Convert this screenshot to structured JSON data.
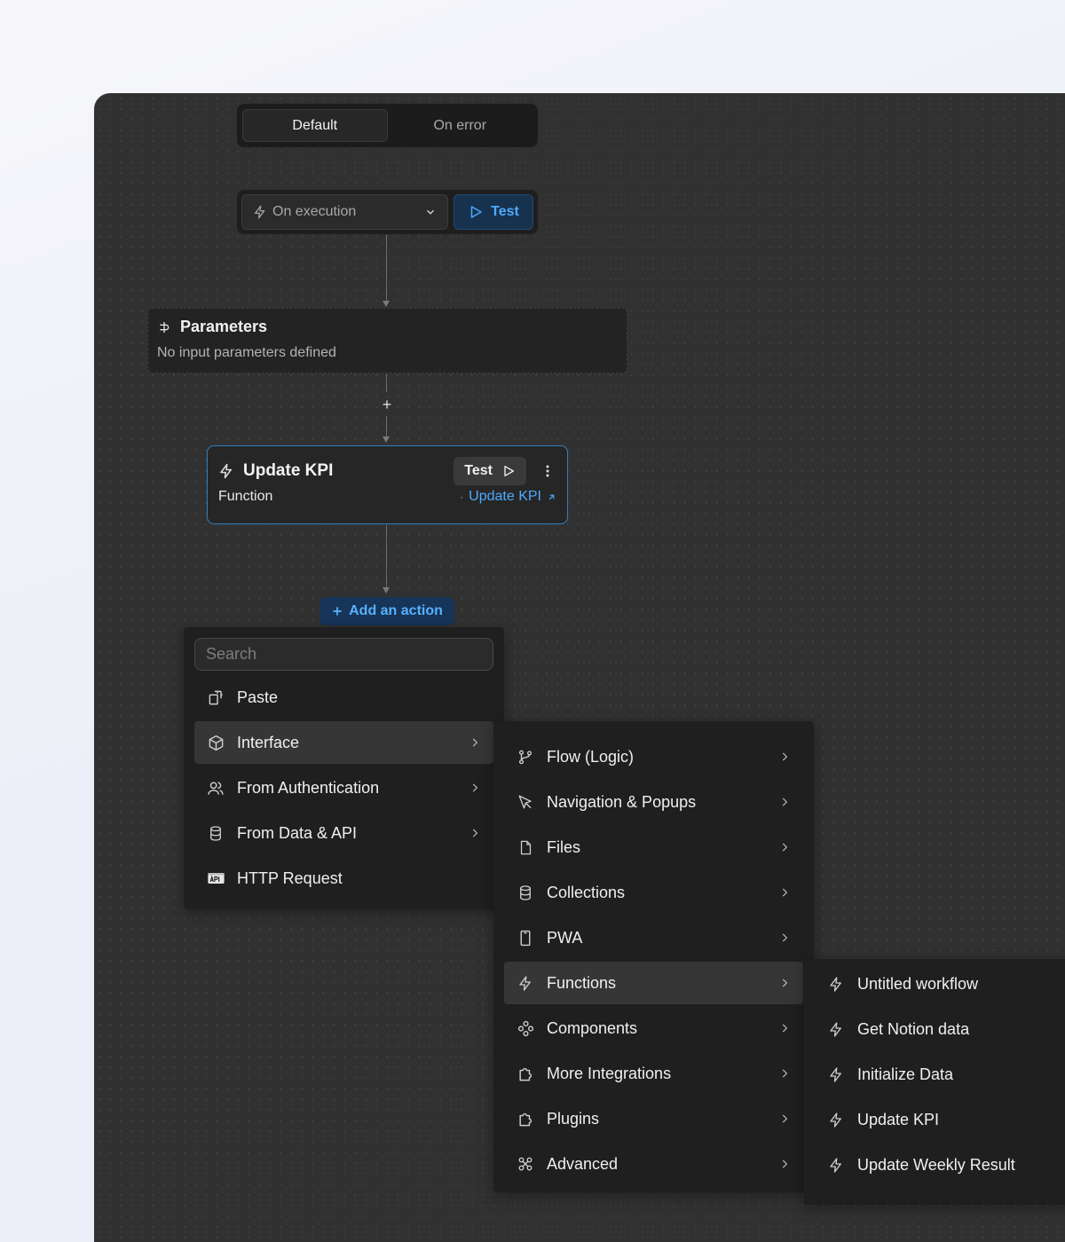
{
  "segmented": {
    "default_label": "Default",
    "on_error_label": "On error"
  },
  "trigger": {
    "select_value": "On execution",
    "test_label": "Test"
  },
  "parameters": {
    "title": "Parameters",
    "subtitle": "No input parameters defined"
  },
  "add_between_label": "+",
  "function_card": {
    "title": "Update KPI",
    "type": "Function",
    "test_label": "Test",
    "link_label": "Update KPI"
  },
  "add_action_label": "Add an action",
  "menu1": {
    "search_placeholder": "Search",
    "items": [
      {
        "label": "Paste",
        "icon": "paste-icon"
      },
      {
        "label": "Interface",
        "icon": "cube-icon"
      },
      {
        "label": "From Authentication",
        "icon": "users-icon"
      },
      {
        "label": "From Data & API",
        "icon": "database-icon"
      },
      {
        "label": "HTTP Request",
        "icon": "api-icon"
      }
    ]
  },
  "menu2": {
    "items": [
      {
        "label": "Flow (Logic)",
        "icon": "git-branch-icon"
      },
      {
        "label": "Navigation & Popups",
        "icon": "cursor-icon"
      },
      {
        "label": "Files",
        "icon": "file-icon"
      },
      {
        "label": "Collections",
        "icon": "database-icon"
      },
      {
        "label": "PWA",
        "icon": "phone-icon"
      },
      {
        "label": "Functions",
        "icon": "bolt-icon"
      },
      {
        "label": "Components",
        "icon": "components-icon"
      },
      {
        "label": "More Integrations",
        "icon": "puzzle-icon"
      },
      {
        "label": "Plugins",
        "icon": "puzzle-icon"
      },
      {
        "label": "Advanced",
        "icon": "advanced-icon"
      }
    ]
  },
  "menu3": {
    "items": [
      {
        "label": "Untitled workflow",
        "icon": "bolt-icon"
      },
      {
        "label": "Get Notion data",
        "icon": "bolt-icon"
      },
      {
        "label": "Initialize Data",
        "icon": "bolt-icon"
      },
      {
        "label": "Update KPI",
        "icon": "bolt-icon"
      },
      {
        "label": "Update Weekly Result",
        "icon": "bolt-icon"
      }
    ]
  }
}
